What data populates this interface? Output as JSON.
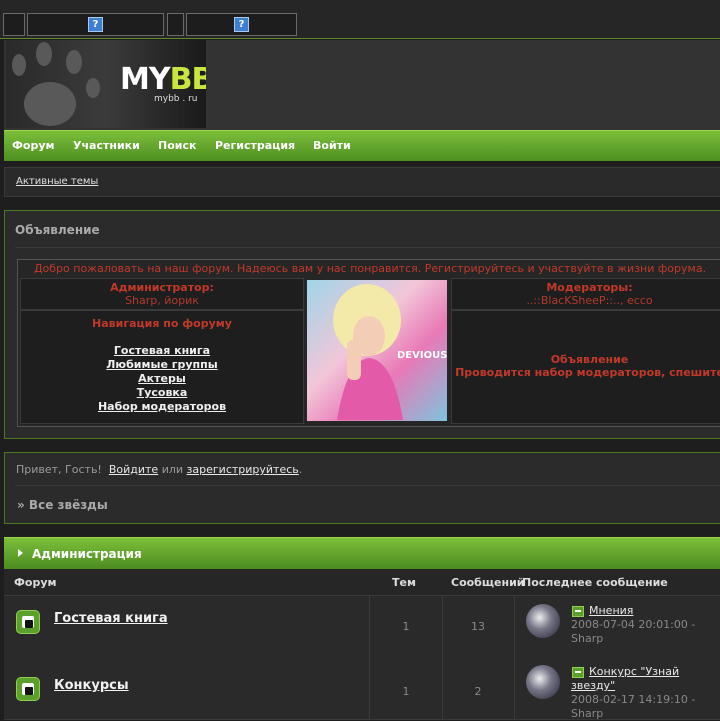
{
  "topbar": {
    "icon_label": "?"
  },
  "header": {
    "logo_main": "MY",
    "logo_accent": "BB",
    "logo_sub": "mybb . ru"
  },
  "nav": {
    "items": [
      "Форум",
      "Участники",
      "Поиск",
      "Регистрация",
      "Войти"
    ]
  },
  "breadcrumb": {
    "active_topics": "Активные темы"
  },
  "announcement": {
    "title": "Объявление",
    "welcome": "Добро пожаловать на наш форум. Надеюсь вам у нас понравится. Регистрируйтесь и участвуйте в жизни форума.",
    "admin_label": "Администратор:",
    "admin_names": "Sharp, йорик",
    "moderators_label": "Модераторы:",
    "moderators_names": "..::BlacKSheeP::.., ecco",
    "nav_title": "Навигация по форуму",
    "nav_links": [
      "Гостевая книга",
      "Любимые группы",
      "Актеры",
      "Тусовка",
      "Набор модераторов"
    ],
    "photo_caption": "DEVIOUS",
    "notice_title": "Объявление",
    "notice_text": "Проводится набор модераторов, спешите"
  },
  "guest": {
    "hello": "Привет, Гость!",
    "login": "Войдите",
    "or": "или",
    "register": "зарегистрируйтесь",
    "dot": "."
  },
  "section": {
    "stars": "» Все звёзды"
  },
  "category": {
    "title": "Администрация"
  },
  "columns": {
    "forum": "Форум",
    "topics": "Тем",
    "posts": "Сообщений",
    "last": "Последнее сообщение"
  },
  "forums": [
    {
      "name": "Гостевая книга",
      "topics": "1",
      "posts": "13",
      "last_title": "Мнения",
      "last_date": "2008-07-04 20:01:00 -",
      "last_author": "Sharp"
    },
    {
      "name": "Конкурсы",
      "topics": "1",
      "posts": "2",
      "last_title": "Конкурс \"Узнай звезду\"",
      "last_date": "2008-02-17 14:19:10 -",
      "last_author": "Sharp"
    }
  ],
  "colors": {
    "accent": "#6aae30",
    "alert": "#c0392b",
    "background": "#1e1e1e"
  }
}
